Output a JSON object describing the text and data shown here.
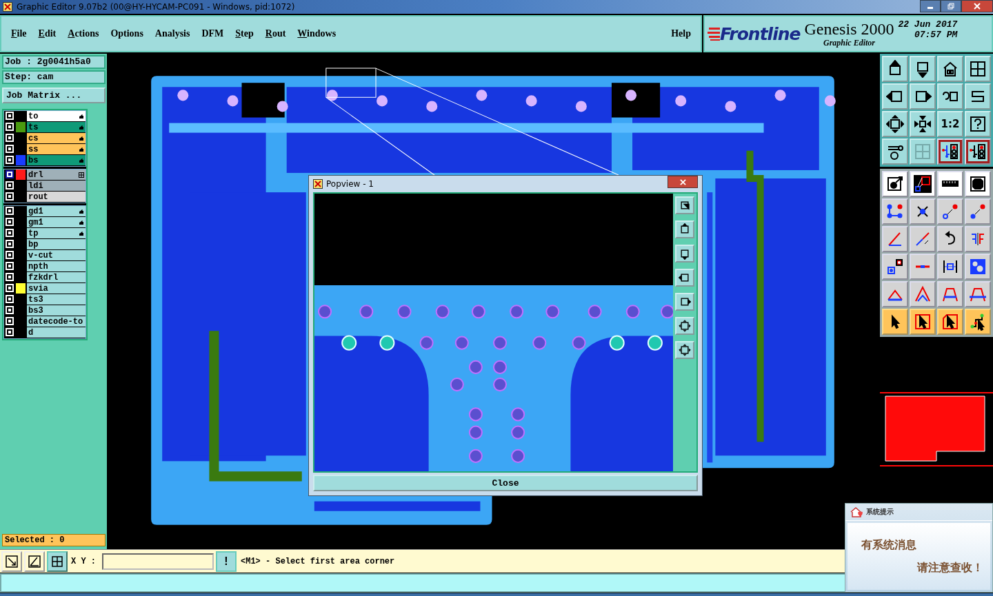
{
  "window": {
    "title": "Graphic Editor 9.07b2 (00@HY-HYCAM-PC091 - Windows, pid:1072)"
  },
  "menu": [
    {
      "label": "File",
      "underline_first": true
    },
    {
      "label": "Edit",
      "underline_first": true
    },
    {
      "label": "Actions",
      "underline_first": true
    },
    {
      "label": "Options",
      "underline_first": false
    },
    {
      "label": "Analysis",
      "underline_first": false
    },
    {
      "label": "DFM",
      "underline_first": false
    },
    {
      "label": "Step",
      "underline_first": true
    },
    {
      "label": "Rout",
      "underline_first": true
    },
    {
      "label": "Windows",
      "underline_first": true
    }
  ],
  "help": "Help",
  "brand": {
    "logo": "Frontline",
    "product": "Genesis 2000",
    "subtitle": "Graphic Editor",
    "date": "22 Jun 2017",
    "time": "07:57 PM"
  },
  "job": {
    "job": "Job : 2g0041h5a0",
    "step": "Step: cam",
    "matrix_button": "Job Matrix ..."
  },
  "layer_groups": [
    {
      "layers": [
        {
          "name": "to",
          "kind": "silk",
          "hand_marker": true,
          "selected": false
        },
        {
          "name": "ts",
          "kind": "mask",
          "color": "#4a9a10",
          "hand_marker": true,
          "selected": false
        },
        {
          "name": "cs",
          "kind": "signal",
          "hand_marker": true,
          "selected": false
        },
        {
          "name": "ss",
          "kind": "signal",
          "hand_marker": true,
          "selected": false
        },
        {
          "name": "bs",
          "kind": "mask",
          "color": "#1a3cff",
          "hand_marker": true,
          "selected": false
        }
      ]
    },
    {
      "layers": [
        {
          "name": "drl",
          "kind": "drill",
          "color": "#ff1a1a",
          "grid_marker": true,
          "selected": true
        },
        {
          "name": "ldi",
          "kind": "drill",
          "selected": false
        },
        {
          "name": "rout",
          "kind": "rout",
          "selected": false
        }
      ]
    },
    {
      "layers": [
        {
          "name": "gd1",
          "kind": "misc",
          "hand_marker": true,
          "selected": false
        },
        {
          "name": "gm1",
          "kind": "misc",
          "hand_marker": true,
          "selected": false
        },
        {
          "name": "tp",
          "kind": "misc",
          "hand_marker": true,
          "selected": false
        },
        {
          "name": "bp",
          "kind": "misc",
          "selected": false
        },
        {
          "name": "v-cut",
          "kind": "misc",
          "selected": false
        },
        {
          "name": "npth",
          "kind": "misc",
          "selected": false
        },
        {
          "name": "fzkdrl",
          "kind": "misc",
          "selected": false
        },
        {
          "name": "svia",
          "kind": "misc",
          "color": "#ffff33",
          "selected": false
        },
        {
          "name": "ts3",
          "kind": "misc",
          "selected": false
        },
        {
          "name": "bs3",
          "kind": "misc",
          "selected": false
        },
        {
          "name": "datecode-to",
          "kind": "misc",
          "selected": false
        },
        {
          "name": "d",
          "kind": "misc",
          "selected": false
        }
      ]
    }
  ],
  "selected_count": "Selected : 0",
  "toolbar": {
    "ratio_label": "1:2"
  },
  "popview": {
    "title": "Popview - 1",
    "close_button": "Close"
  },
  "status": {
    "xy_label": "X Y :",
    "alert_button": "!",
    "message": "<M1> - Select first area corner"
  },
  "notification": {
    "title": "系统提示",
    "line_1": "有系统消息",
    "line_2": "请注意查收！"
  }
}
